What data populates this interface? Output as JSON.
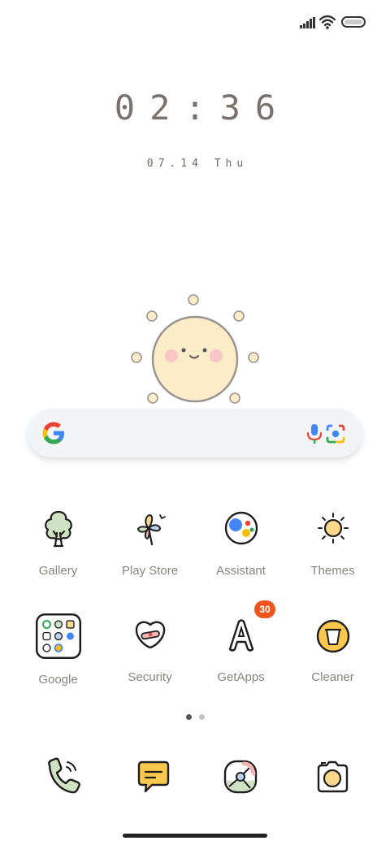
{
  "status_bar": {
    "signal_icon": "signal-icon",
    "wifi_icon": "wifi-icon",
    "battery_icon": "battery-icon"
  },
  "clock": {
    "time": "02:36",
    "date": "07.14 Thu"
  },
  "widget": {
    "icon": "sun-face-icon"
  },
  "search": {
    "logo_icon": "google-logo-icon",
    "mic_icon": "microphone-icon",
    "lens_icon": "camera-lens-icon"
  },
  "apps_row1": [
    {
      "label": "Gallery",
      "icon": "tree-icon"
    },
    {
      "label": "Play Store",
      "icon": "pinwheel-icon"
    },
    {
      "label": "Assistant",
      "icon": "assistant-icon"
    },
    {
      "label": "Themes",
      "icon": "sun-icon"
    }
  ],
  "apps_row2": [
    {
      "label": "Google",
      "icon": "folder-icon"
    },
    {
      "label": "Security",
      "icon": "heart-bandage-icon"
    },
    {
      "label": "GetApps",
      "icon": "letter-a-icon",
      "badge": "30"
    },
    {
      "label": "Cleaner",
      "icon": "trash-icon"
    }
  ],
  "page_dots": {
    "count": 2,
    "active": 1
  },
  "dock": [
    {
      "icon": "phone-icon"
    },
    {
      "icon": "message-icon"
    },
    {
      "icon": "browser-icon"
    },
    {
      "icon": "camera-icon"
    }
  ],
  "colors": {
    "accent_badge": "#f0541e",
    "sun_fill": "#fdecc8",
    "leaf_green": "#cfe3c4",
    "text_gray": "#888580"
  }
}
